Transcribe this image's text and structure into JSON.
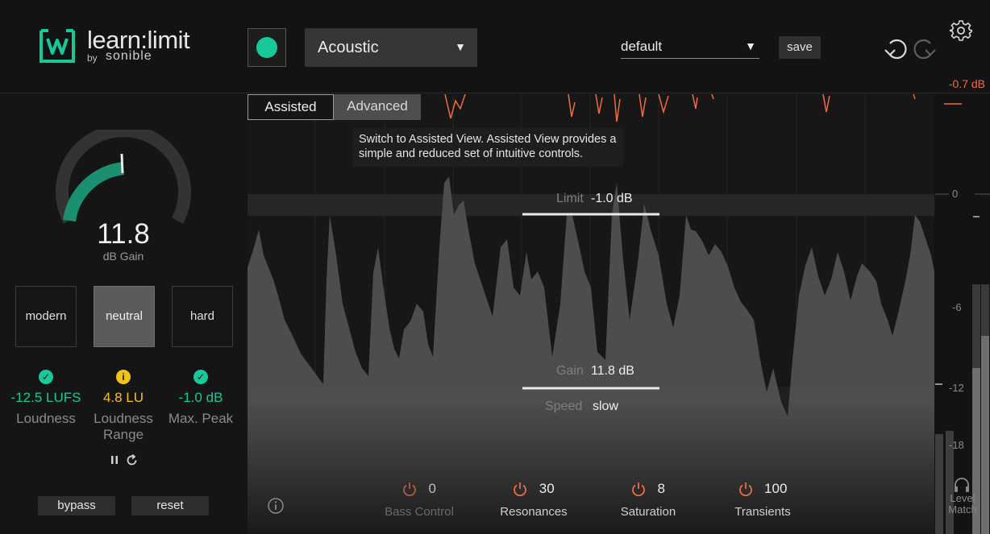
{
  "app": {
    "title": "learn:limit",
    "by": "by",
    "brand": "sonible"
  },
  "header": {
    "profile": "Acoustic",
    "preset": "default",
    "save_label": "save",
    "peak_readout": "-0.7 dB"
  },
  "left": {
    "gain_value": "11.8",
    "gain_unit": "dB Gain",
    "gain_level_fraction": 0.5,
    "modes": [
      "modern",
      "neutral",
      "hard"
    ],
    "active_mode": "neutral",
    "metrics": [
      {
        "value": "-12.5 LUFS",
        "name": "Loudness",
        "status": "ok"
      },
      {
        "value": "4.8 LU",
        "name": "Loudness Range",
        "status": "warn"
      },
      {
        "value": "-1.0 dB",
        "name": "Max. Peak",
        "status": "ok"
      }
    ],
    "bypass_label": "bypass",
    "reset_label": "reset"
  },
  "main": {
    "tabs": {
      "assisted": "Assisted",
      "advanced": "Advanced"
    },
    "tooltip": "Switch to Assisted View. Assisted View provides a simple and reduced set of intuitive controls.",
    "limit": {
      "label": "Limit",
      "value": "-1.0 dB"
    },
    "gain": {
      "label": "Gain",
      "value": "11.8 dB"
    },
    "speed": {
      "label": "Speed",
      "value": "slow"
    },
    "controls": [
      {
        "name": "Bass Control",
        "value": "0",
        "enabled": false
      },
      {
        "name": "Resonances",
        "value": "30",
        "enabled": true
      },
      {
        "name": "Saturation",
        "value": "8",
        "enabled": true
      },
      {
        "name": "Transients",
        "value": "100",
        "enabled": true
      }
    ]
  },
  "meter": {
    "ticks": [
      "0",
      "-6",
      "-12",
      "-18"
    ],
    "level_match_label": "Level Match"
  },
  "colors": {
    "accent": "#17c99a",
    "warning": "#f2c21c",
    "peak": "#f06a45"
  }
}
